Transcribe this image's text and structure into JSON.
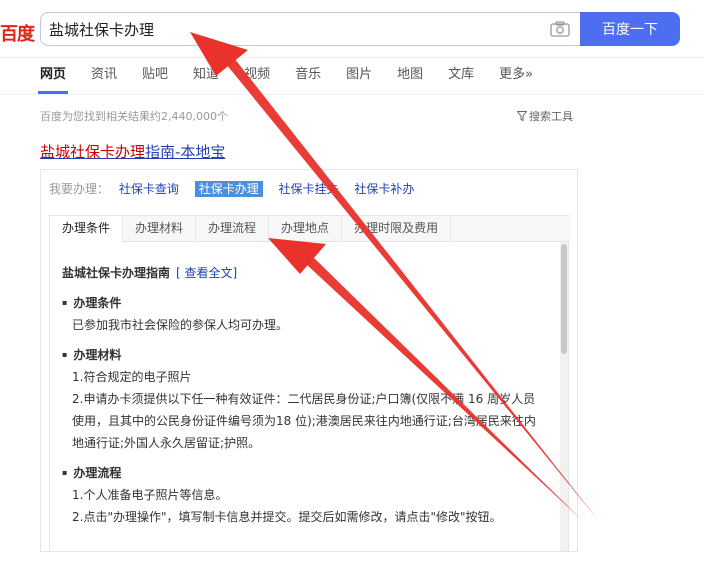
{
  "logo": {
    "text": "百度"
  },
  "search": {
    "value": "盐城社保卡办理",
    "button_label": "百度一下"
  },
  "tabs": [
    {
      "label": "网页",
      "active": true
    },
    {
      "label": "资讯"
    },
    {
      "label": "贴吧"
    },
    {
      "label": "知道"
    },
    {
      "label": "视频"
    },
    {
      "label": "音乐"
    },
    {
      "label": "图片"
    },
    {
      "label": "地图"
    },
    {
      "label": "文库"
    },
    {
      "label": "更多»"
    }
  ],
  "result_count": "百度为您找到相关结果约2,440,000个",
  "search_tools": "搜索工具",
  "result": {
    "title_highlight": "盐城社保卡办理",
    "title_rest": "指南-本地宝"
  },
  "card": {
    "label": "我要办理：",
    "links": [
      "社保卡查询",
      "社保卡办理",
      "社保卡挂失",
      "社保卡补办"
    ],
    "inner_tabs": [
      "办理条件",
      "办理材料",
      "办理流程",
      "办理地点",
      "办理时限及费用"
    ],
    "guide_title": "盐城社保卡办理指南",
    "guide_more": "[ 查看全文]",
    "sections": [
      {
        "heading": "办理条件",
        "lines": [
          "已参加我市社会保险的参保人均可办理。"
        ]
      },
      {
        "heading": "办理材料",
        "lines": [
          "1.符合规定的电子照片",
          "2.申请办卡须提供以下任一种有效证件：二代居民身份证;户口簿(仅限不满 16 周岁人员使用，且其中的公民身份证件编号须为18 位);港澳居民来往内地通行证;台湾居民来往内地通行证;外国人永久居留证;护照。"
        ]
      },
      {
        "heading": "办理流程",
        "lines": [
          "1.个人准备电子照片等信息。",
          "2.点击\"办理操作\"，填写制卡信息并提交。提交后如需修改，请点击\"修改\"按钮。"
        ]
      }
    ]
  },
  "colors": {
    "brand_blue": "#4e6ef2",
    "link_blue": "#2440b3",
    "highlight_red": "#c00",
    "arrow_red": "#e8322b"
  }
}
